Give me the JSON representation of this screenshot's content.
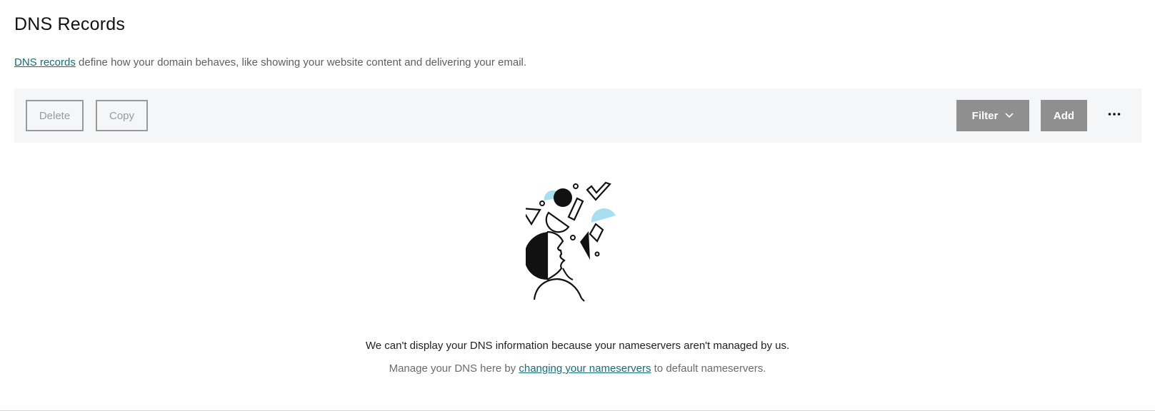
{
  "page": {
    "title": "DNS Records",
    "description": {
      "link_text": "DNS records",
      "text": " define how your domain behaves, like showing your website content and delivering your email."
    }
  },
  "toolbar": {
    "delete_label": "Delete",
    "copy_label": "Copy",
    "filter_label": "Filter",
    "add_label": "Add",
    "more_icon": "more-horizontal-icon",
    "filter_icon": "chevron-down-icon"
  },
  "empty_state": {
    "illustration": "person-thinking-shapes-illustration",
    "message": "We can't display your DNS information because your nameservers aren't managed by us.",
    "sub_message_prefix": "Manage your DNS here by ",
    "sub_message_link": "changing your nameservers",
    "sub_message_suffix": " to default nameservers."
  },
  "colors": {
    "link": "#1b6b72",
    "toolbar_bg": "#f5f6f8",
    "button_disabled": "#8f8f8f",
    "accent_shape": "#a8dff0"
  }
}
